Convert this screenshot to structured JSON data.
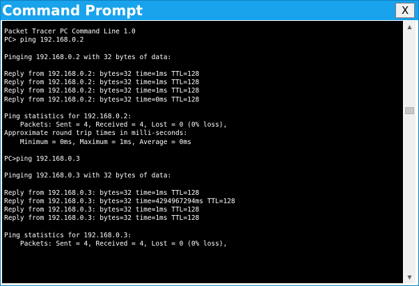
{
  "window": {
    "title": "Command Prompt",
    "close_label": "X"
  },
  "scrollbar": {
    "up_icon": "▲",
    "down_icon": "▼",
    "position": 0.32
  },
  "console": {
    "lines": [
      "Packet Tracer PC Command Line 1.0",
      "PC> ping 192.168.0.2",
      "",
      "Pinging 192.168.0.2 with 32 bytes of data:",
      "",
      "Reply from 192.168.0.2: bytes=32 time=1ms TTL=128",
      "Reply from 192.168.0.2: bytes=32 time=1ms TTL=128",
      "Reply from 192.168.0.2: bytes=32 time=1ms TTL=128",
      "Reply from 192.168.0.2: bytes=32 time=0ms TTL=128",
      "",
      "Ping statistics for 192.168.0.2:",
      "    Packets: Sent = 4, Received = 4, Lost = 0 (0% loss),",
      "Approximate round trip times in milli-seconds:",
      "    Minimum = 0ms, Maximum = 1ms, Average = 0ms",
      "",
      "PC>ping 192.168.0.3",
      "",
      "Pinging 192.168.0.3 with 32 bytes of data:",
      "",
      "Reply from 192.168.0.3: bytes=32 time=1ms TTL=128",
      "Reply from 192.168.0.3: bytes=32 time=4294967294ms TTL=128",
      "Reply from 192.168.0.3: bytes=32 time=1ms TTL=128",
      "Reply from 192.168.0.3: bytes=32 time=1ms TTL=128",
      "",
      "Ping statistics for 192.168.0.3:",
      "    Packets: Sent = 4, Received = 4, Lost = 0 (0% loss),"
    ]
  }
}
